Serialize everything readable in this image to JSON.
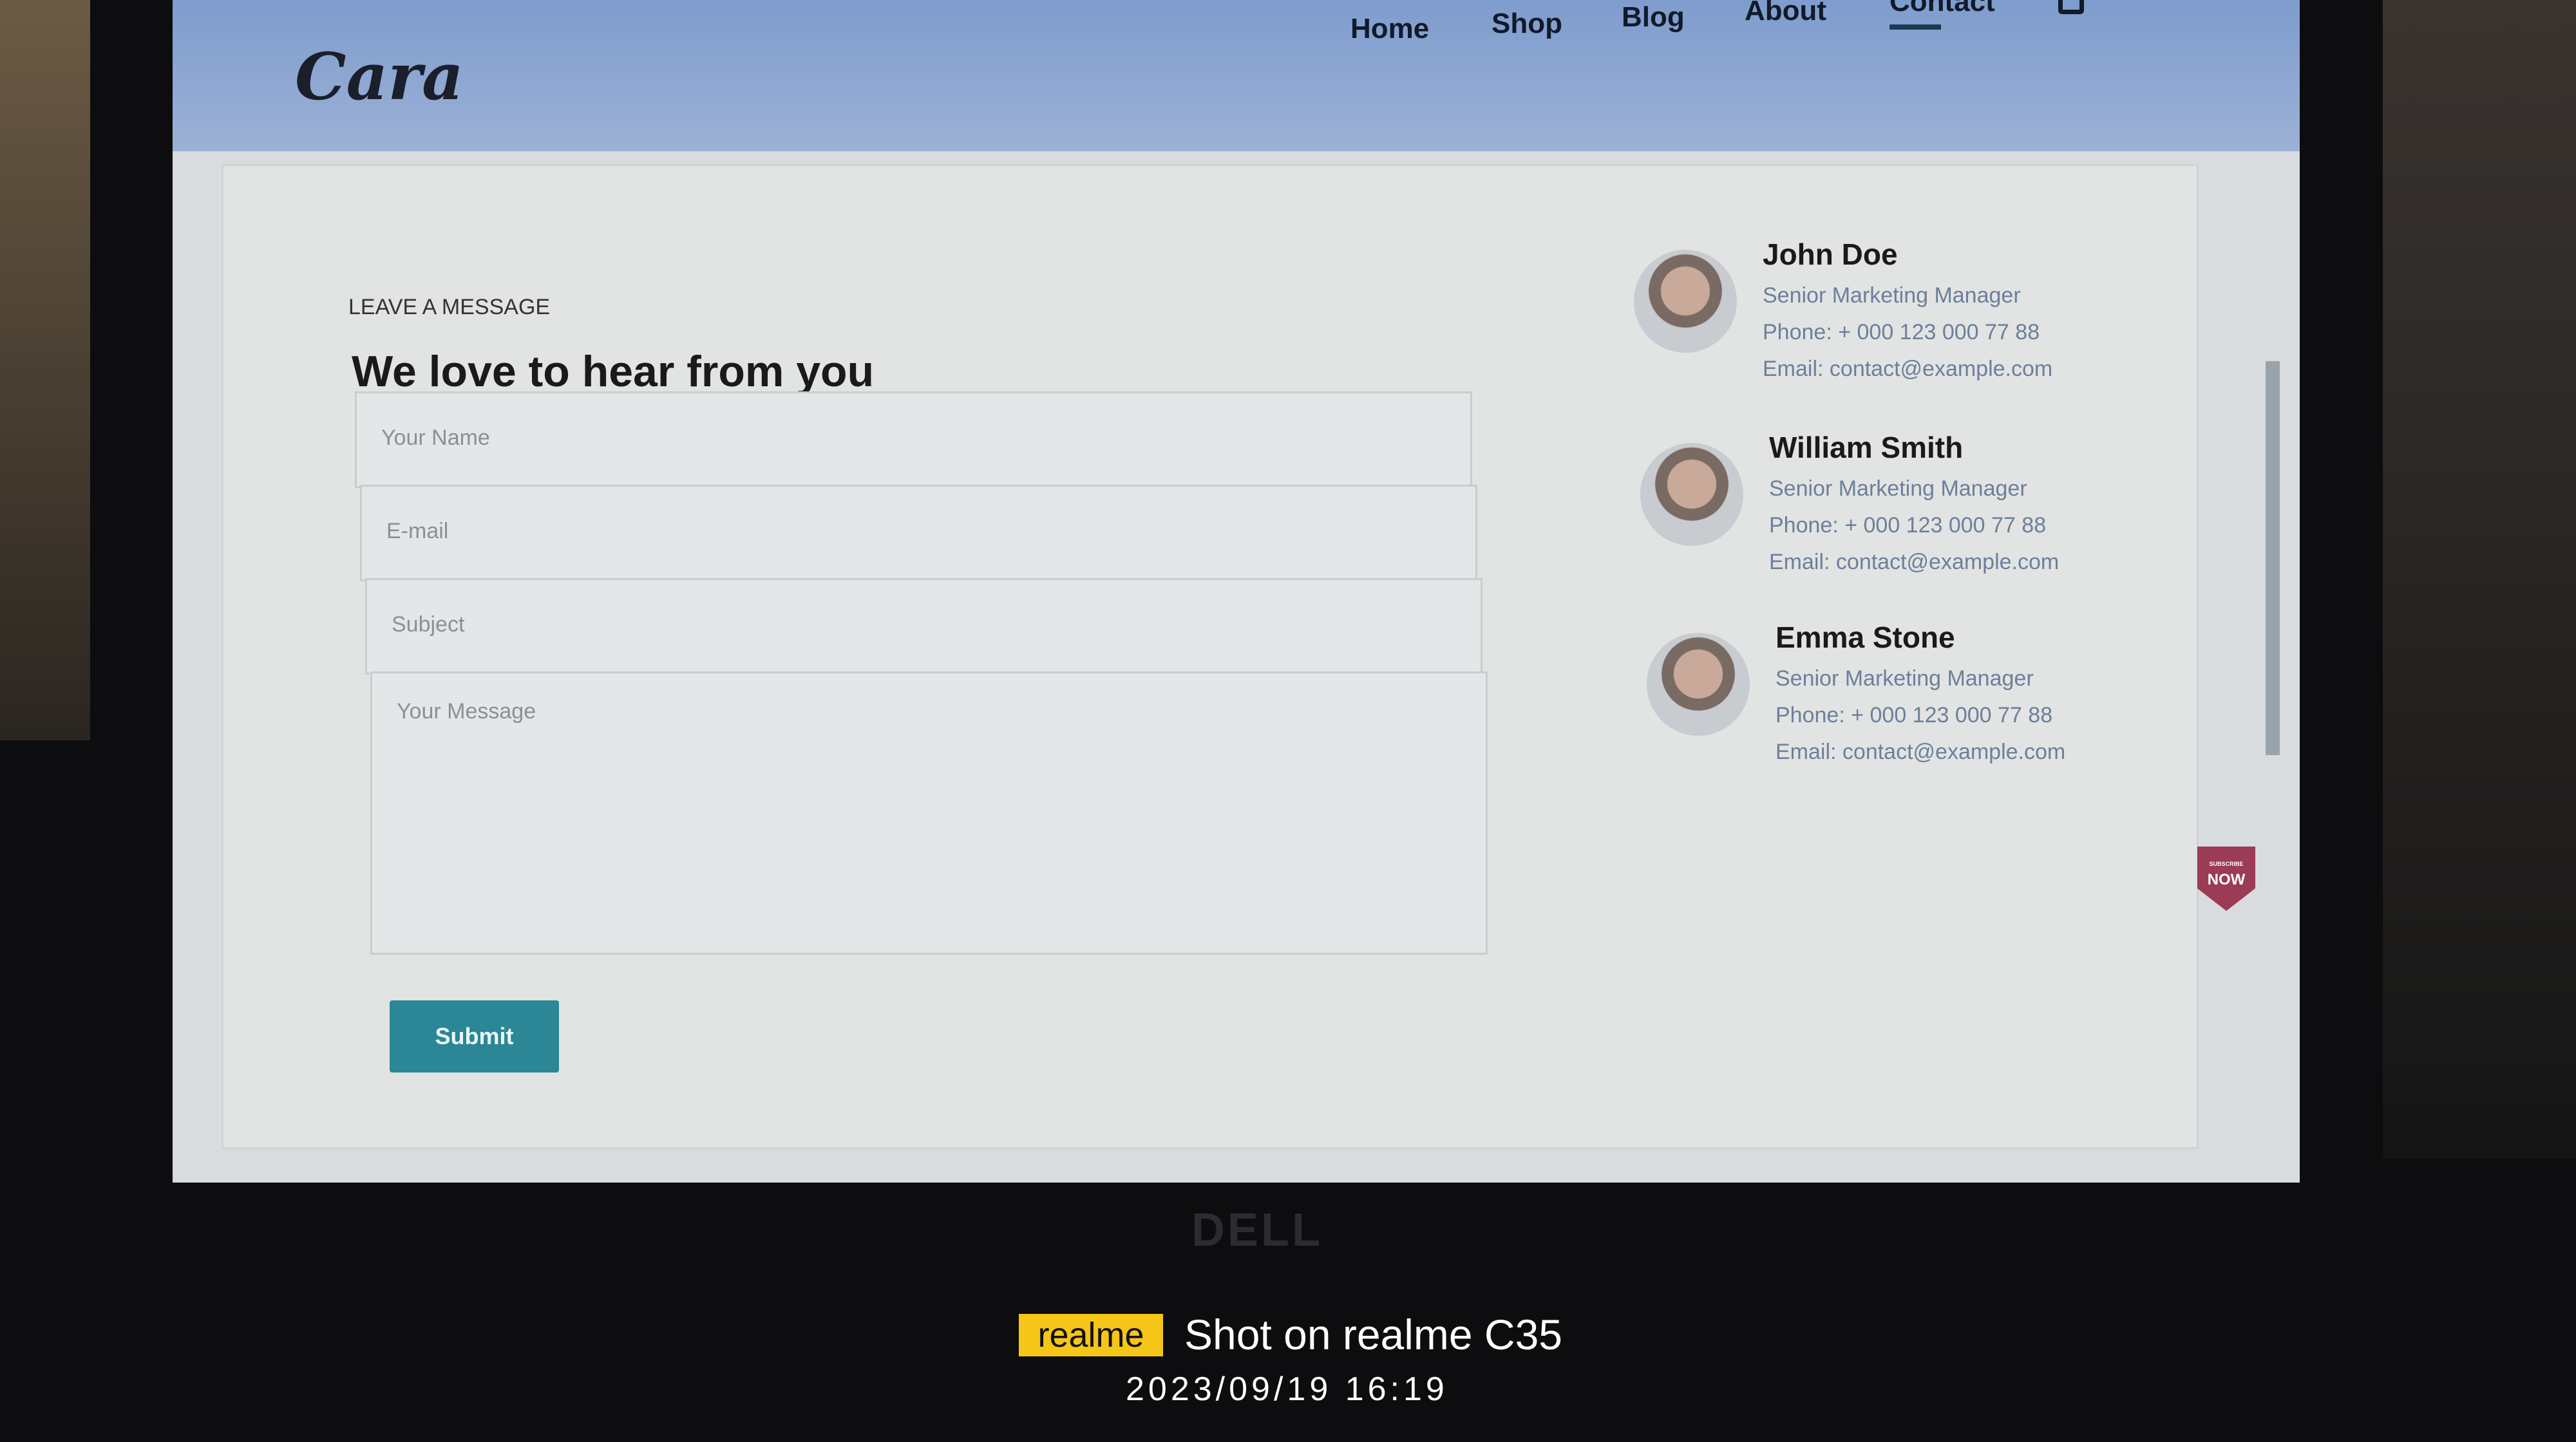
{
  "header": {
    "logo": "Cara",
    "nav": [
      "Home",
      "Shop",
      "Blog",
      "About",
      "Contact"
    ],
    "active": "Contact"
  },
  "form": {
    "eyebrow": "LEAVE A MESSAGE",
    "heading": "We love to hear from you",
    "name_placeholder": "Your Name",
    "email_placeholder": "E-mail",
    "subject_placeholder": "Subject",
    "message_placeholder": "Your Message",
    "submit_label": "Submit"
  },
  "contacts": [
    {
      "name": "John Doe",
      "title": "Senior Marketing Manager",
      "phone": "Phone: + 000 123 000 77 88",
      "email": "Email: contact@example.com"
    },
    {
      "name": "William Smith",
      "title": "Senior Marketing Manager",
      "phone": "Phone: + 000 123 000 77 88",
      "email": "Email: contact@example.com"
    },
    {
      "name": "Emma Stone",
      "title": "Senior Marketing Manager",
      "phone": "Phone: + 000 123 000 77 88",
      "email": "Email: contact@example.com"
    }
  ],
  "badge": {
    "top": "SUBSCRIBE",
    "main": "NOW"
  },
  "monitor_brand": "DELL",
  "watermark": {
    "brand": "realme",
    "text": "Shot on realme C35",
    "datetime": "2023/09/19  16:19"
  },
  "colors": {
    "header": "#7e9ccd",
    "submit": "#2b8795",
    "badge": "#9b3b55"
  }
}
